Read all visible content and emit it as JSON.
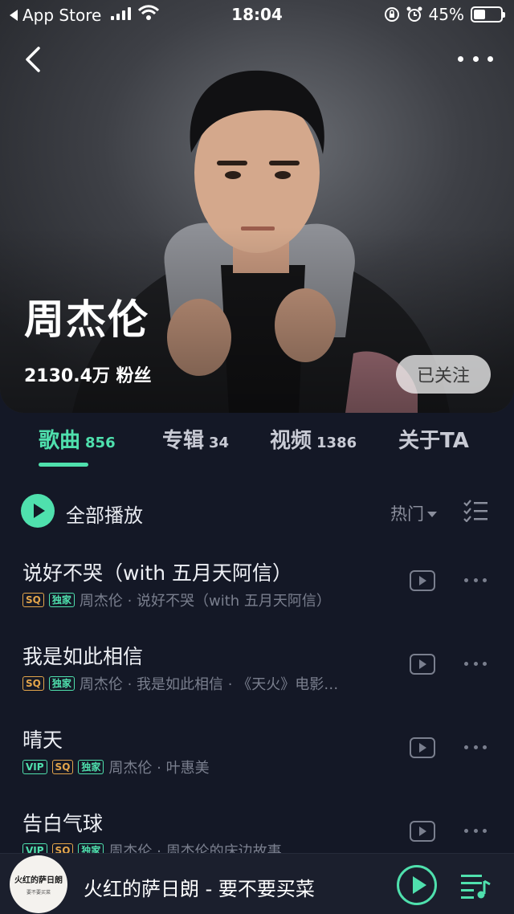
{
  "status_bar": {
    "back_app": "App Store",
    "time": "18:04",
    "battery": "45%",
    "battery_level": 0.45
  },
  "artist": {
    "name": "周杰伦",
    "fans": "2130.4万 粉丝",
    "follow_label": "已关注"
  },
  "tabs": [
    {
      "label": "歌曲",
      "count": "856"
    },
    {
      "label": "专辑",
      "count": "34"
    },
    {
      "label": "视频",
      "count": "1386"
    },
    {
      "label": "关于TA",
      "count": ""
    }
  ],
  "toolbar": {
    "play_all_label": "全部播放",
    "sort_label": "热门"
  },
  "songs": [
    {
      "title": "说好不哭（with 五月天阿信）",
      "badges": [
        "SQ",
        "独家"
      ],
      "meta": "周杰伦 · 说好不哭（with 五月天阿信）"
    },
    {
      "title": "我是如此相信",
      "badges": [
        "SQ",
        "独家"
      ],
      "meta": "周杰伦 · 我是如此相信 · 《天火》电影…"
    },
    {
      "title": "晴天",
      "badges": [
        "VIP",
        "SQ",
        "独家"
      ],
      "meta": "周杰伦 · 叶惠美"
    },
    {
      "title": "告白气球",
      "badges": [
        "VIP",
        "SQ",
        "独家"
      ],
      "meta": "周杰伦 · 周杰伦的床边故事"
    }
  ],
  "mini_player": {
    "title": "火红的萨日朗 - 要不要买菜",
    "cover_text": "火红的萨日朗",
    "cover_subtext": "要不要买菜"
  },
  "colors": {
    "accent": "#4fe0ad",
    "background": "#141826",
    "sq_badge": "#e3a54b"
  }
}
